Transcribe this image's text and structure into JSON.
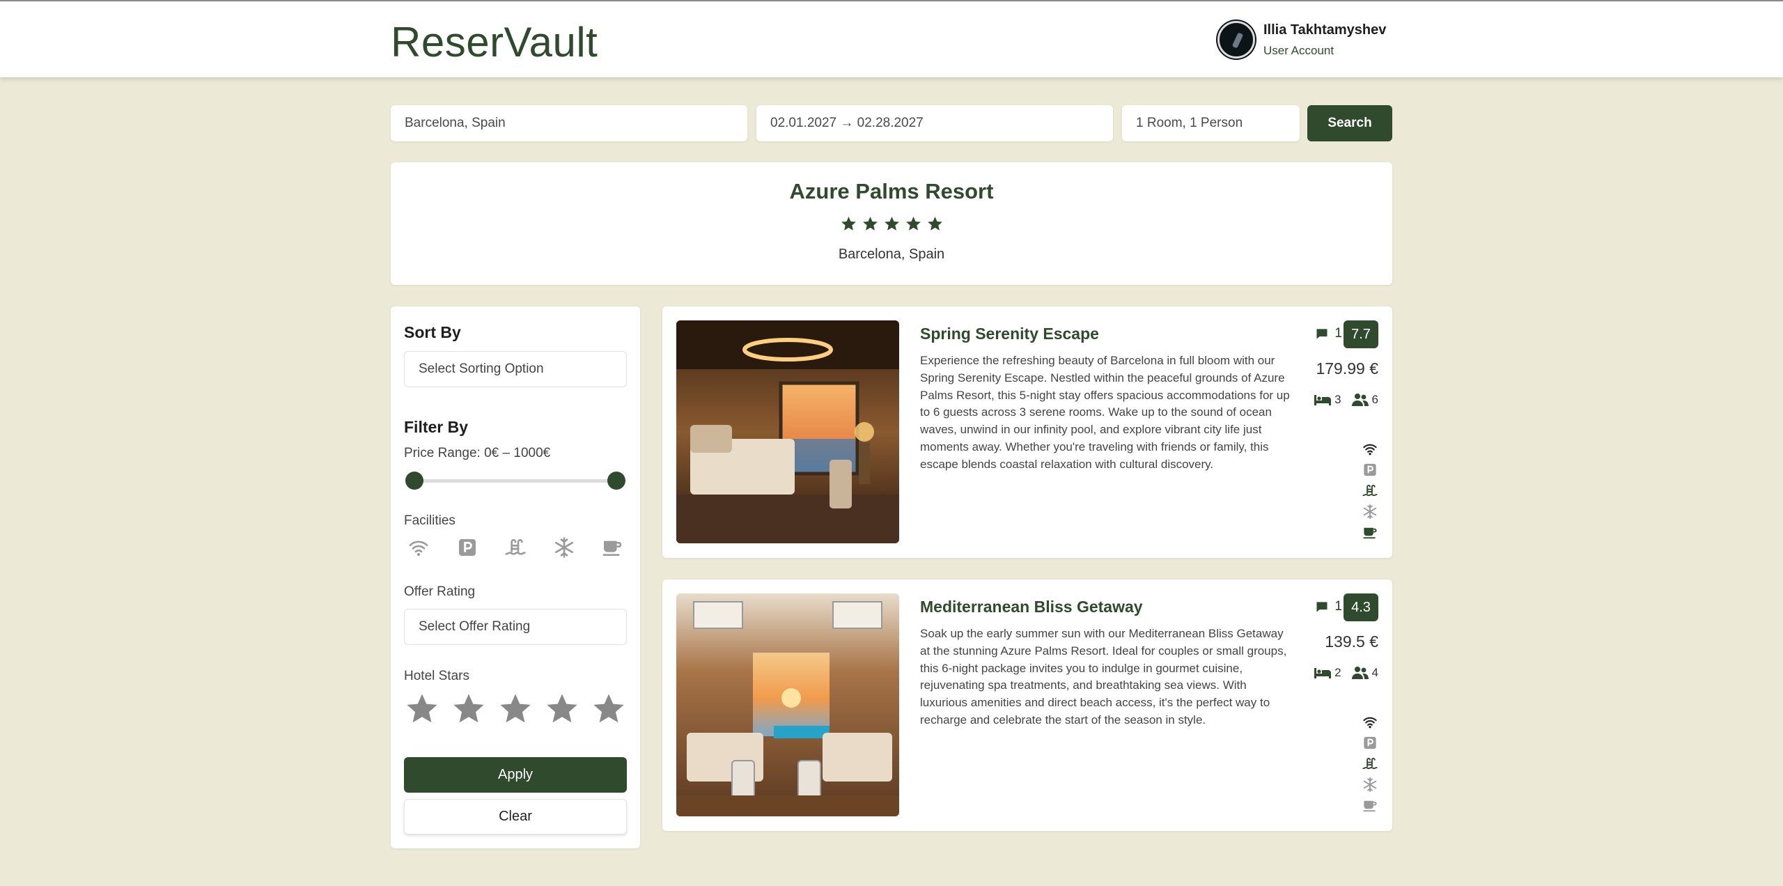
{
  "app": {
    "logo": "ReserVault",
    "accent_color": "#2f4a2c",
    "background_color": "#ece9d6"
  },
  "user": {
    "name": "Illia Takhtamyshev",
    "role": "User Account"
  },
  "search": {
    "destination": "Barcelona, Spain",
    "dates": "02.01.2027 → 02.28.2027",
    "guests": "1 Room, 1 Person",
    "button": "Search"
  },
  "hotel": {
    "name": "Azure Palms Resort",
    "stars": 5,
    "location": "Barcelona, Spain"
  },
  "sidebar": {
    "sort_title": "Sort By",
    "sort_placeholder": "Select Sorting Option",
    "filter_title": "Filter By",
    "price_range_label": "Price Range: 0€ – 1000€",
    "price_range": {
      "min": 0,
      "max": 1000,
      "selected_min": 0,
      "selected_max": 1000
    },
    "facilities_label": "Facilities",
    "facilities": [
      "wifi-icon",
      "parking-icon",
      "pool-icon",
      "air-conditioning-icon",
      "breakfast-icon"
    ],
    "offer_rating_label": "Offer Rating",
    "offer_rating_placeholder": "Select Offer Rating",
    "hotel_stars_label": "Hotel Stars",
    "hotel_stars_selected": 0,
    "apply": "Apply",
    "clear": "Clear"
  },
  "offers": [
    {
      "title": "Spring Serenity Escape",
      "description": "Experience the refreshing beauty of Barcelona in full bloom with our Spring Serenity Escape. Nestled within the peaceful grounds of Azure Palms Resort, this 5-night stay offers spacious accommodations for up to 6 guests across 3 serene rooms. Wake up to the sound of ocean waves, unwind in our infinity pool, and explore vibrant city life just moments away. Whether you're traveling with friends or family, this escape blends coastal relaxation with cultural discovery.",
      "reviews": "1",
      "score": "7.7",
      "price": "179.99 €",
      "rooms": "3",
      "persons": "6",
      "amenities": [
        "wifi-icon",
        "parking-icon",
        "pool-icon",
        "air-conditioning-icon",
        "breakfast-icon"
      ]
    },
    {
      "title": "Mediterranean Bliss Getaway",
      "description": "Soak up the early summer sun with our Mediterranean Bliss Getaway at the stunning Azure Palms Resort. Ideal for couples or small groups, this 6-night package invites you to indulge in gourmet cuisine, rejuvenating spa treatments, and breathtaking sea views. With luxurious amenities and direct beach access, it's the perfect way to recharge and celebrate the start of the season in style.",
      "reviews": "1",
      "score": "4.3",
      "price": "139.5 €",
      "rooms": "2",
      "persons": "4",
      "amenities": [
        "wifi-icon",
        "parking-icon",
        "pool-icon",
        "air-conditioning-icon",
        "breakfast-icon"
      ]
    }
  ]
}
